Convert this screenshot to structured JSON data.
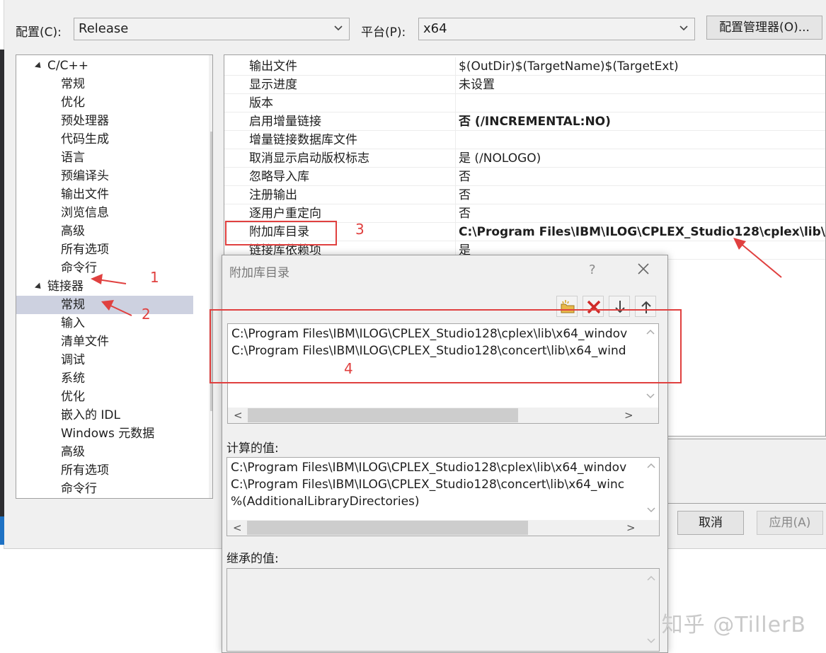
{
  "header": {
    "config_label": "配置(C):",
    "config_value": "Release",
    "platform_label": "平台(P):",
    "platform_value": "x64",
    "config_manager_button": "配置管理器(O)..."
  },
  "tree": {
    "items": [
      {
        "label": "C/C++",
        "expanded": true
      },
      {
        "label": "常规"
      },
      {
        "label": "优化"
      },
      {
        "label": "预处理器"
      },
      {
        "label": "代码生成"
      },
      {
        "label": "语言"
      },
      {
        "label": "预编译头"
      },
      {
        "label": "输出文件"
      },
      {
        "label": "浏览信息"
      },
      {
        "label": "高级"
      },
      {
        "label": "所有选项"
      },
      {
        "label": "命令行"
      },
      {
        "label": "链接器",
        "expanded": true
      },
      {
        "label": "常规",
        "selected": true
      },
      {
        "label": "输入"
      },
      {
        "label": "清单文件"
      },
      {
        "label": "调试"
      },
      {
        "label": "系统"
      },
      {
        "label": "优化"
      },
      {
        "label": "嵌入的 IDL"
      },
      {
        "label": "Windows 元数据"
      },
      {
        "label": "高级"
      },
      {
        "label": "所有选项"
      },
      {
        "label": "命令行"
      }
    ]
  },
  "grid": {
    "rows": [
      {
        "name": "输出文件",
        "value": "$(OutDir)$(TargetName)$(TargetExt)",
        "bold": false
      },
      {
        "name": "显示进度",
        "value": "未设置",
        "bold": false
      },
      {
        "name": "版本",
        "value": "",
        "bold": false
      },
      {
        "name": "启用增量链接",
        "value": "否 (/INCREMENTAL:NO)",
        "bold": true
      },
      {
        "name": "增量链接数据库文件",
        "value": "",
        "bold": false
      },
      {
        "name": "取消显示启动版权标志",
        "value": "是 (/NOLOGO)",
        "bold": false
      },
      {
        "name": "忽略导入库",
        "value": "否",
        "bold": false
      },
      {
        "name": "注册输出",
        "value": "否",
        "bold": false
      },
      {
        "name": "逐用户重定向",
        "value": "否",
        "bold": false
      },
      {
        "name": "附加库目录",
        "value": "C:\\Program Files\\IBM\\ILOG\\CPLEX_Studio128\\cplex\\lib\\x",
        "bold": true
      },
      {
        "name": "链接库依赖项",
        "value": "是",
        "bold": false
      }
    ]
  },
  "annotations": {
    "n1": "1",
    "n2": "2",
    "n3": "3",
    "n4": "4",
    "color": "#e0403f"
  },
  "dialog": {
    "title": "附加库目录",
    "help": "?",
    "entries": [
      "C:\\Program Files\\IBM\\ILOG\\CPLEX_Studio128\\cplex\\lib\\x64_windov",
      "C:\\Program Files\\IBM\\ILOG\\CPLEX_Studio128\\concert\\lib\\x64_wind"
    ],
    "computed_label": "计算的值:",
    "computed": [
      "C:\\Program Files\\IBM\\ILOG\\CPLEX_Studio128\\cplex\\lib\\x64_windov",
      "C:\\Program Files\\IBM\\ILOG\\CPLEX_Studio128\\concert\\lib\\x64_winc",
      "%(AdditionalLibraryDirectories)"
    ],
    "inherited_label": "继承的值:"
  },
  "footer": {
    "cancel": "取消",
    "apply": "应用(A)"
  },
  "watermark": "知乎 @TillerB"
}
